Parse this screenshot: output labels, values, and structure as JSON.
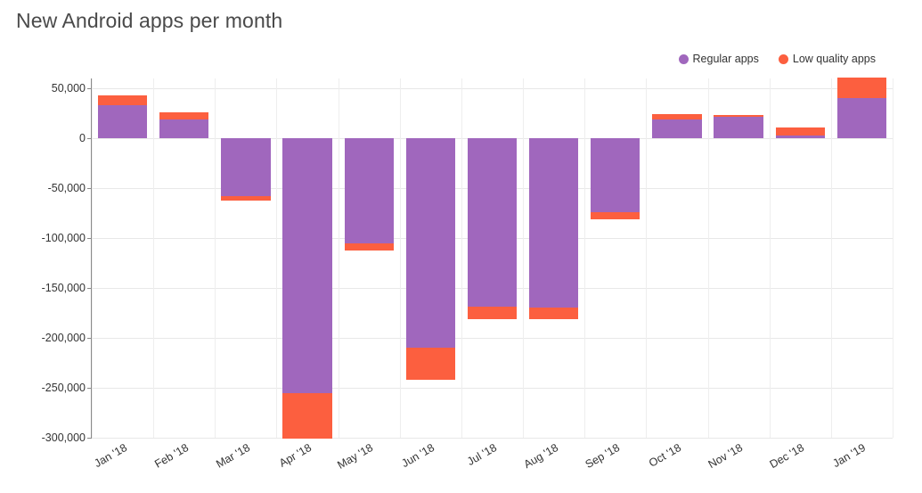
{
  "chart_title": "New Android apps per month",
  "legend": {
    "position": "top-right",
    "items": [
      {
        "label": "Regular apps",
        "color": "#a067bd",
        "marker": "circle-dot-icon"
      },
      {
        "label": "Low quality apps",
        "color": "#fc5f3f",
        "marker": "circle-dot-icon"
      }
    ]
  },
  "chart_data": {
    "type": "bar",
    "stacked": true,
    "title": "New Android apps per month",
    "xlabel": "",
    "ylabel": "",
    "grid": true,
    "legend_position": "top-right",
    "categories": [
      "Jan '18",
      "Feb '18",
      "Mar '18",
      "Apr '18",
      "May '18",
      "Jun '18",
      "Jul '18",
      "Aug '18",
      "Sep '18",
      "Oct '18",
      "Nov '18",
      "Dec '18",
      "Jan '19"
    ],
    "series": [
      {
        "name": "Regular apps",
        "color": "#a067bd",
        "values": [
          33000,
          26000,
          -58000,
          -255000,
          -105000,
          -210000,
          -169000,
          -170000,
          -74000,
          19000,
          22000,
          3000,
          40000
        ]
      },
      {
        "name": "Low quality apps",
        "color": "#fc5f3f",
        "values": [
          10000,
          -7000,
          -4000,
          -46000,
          -7000,
          -32000,
          -12000,
          -11000,
          -7000,
          5000,
          1000,
          8000,
          21000
        ]
      }
    ],
    "totals": [
      43000,
      19000,
      -62000,
      -301000,
      -112000,
      -242000,
      -181000,
      -181000,
      -81000,
      24000,
      23000,
      11000,
      61000
    ],
    "ylim": [
      -300000,
      60000
    ],
    "yticks": [
      50000,
      0,
      -50000,
      -100000,
      -150000,
      -200000,
      -250000,
      -300000
    ],
    "ytick_labels": [
      "50,000",
      "0",
      "-50,000",
      "-100,000",
      "-150,000",
      "-200,000",
      "-250,000",
      "-300,000"
    ]
  }
}
